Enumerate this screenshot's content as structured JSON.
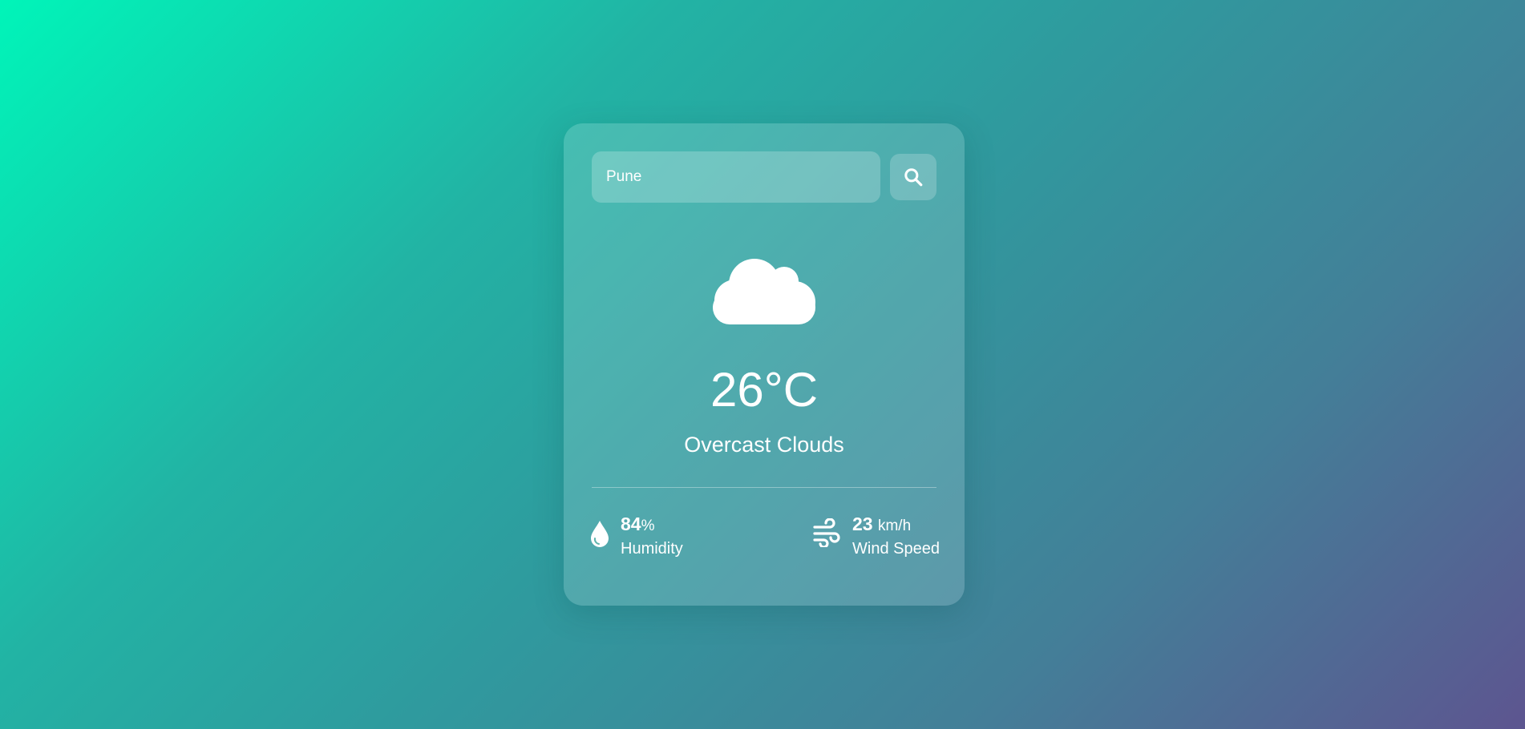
{
  "search": {
    "value": "Pune",
    "button_icon": "search-icon"
  },
  "weather": {
    "icon": "cloud-icon",
    "temperature": "26°C",
    "description": "Overcast Clouds"
  },
  "humidity": {
    "icon": "water-drop-icon",
    "value": "84",
    "unit": "%",
    "label": "Humidity"
  },
  "wind": {
    "icon": "wind-icon",
    "value": "23",
    "unit": "km/h",
    "label": "Wind Speed"
  },
  "colors": {
    "gradient_start": "#00f5b9",
    "gradient_end": "#5d5590",
    "text": "#ffffff"
  }
}
